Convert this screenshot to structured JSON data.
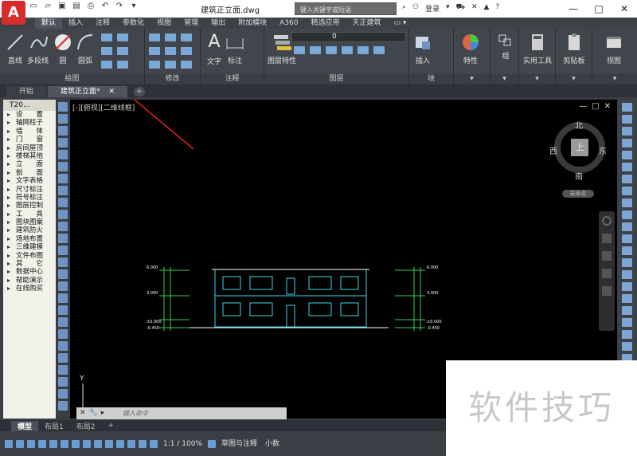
{
  "app": {
    "logo": "A",
    "doc_title": "建筑正立面.dwg"
  },
  "search": {
    "placeholder": "键入关键字或短语"
  },
  "login": {
    "label": "登录"
  },
  "window_controls": {
    "minimize": "—",
    "maximize": "□",
    "close": "✕"
  },
  "ribbon_tabs": [
    "默认",
    "插入",
    "注释",
    "参数化",
    "视图",
    "管理",
    "输出",
    "附加模块",
    "A360",
    "精选应用",
    "天正建筑"
  ],
  "active_ribbon_tab": "默认",
  "draw_panel": {
    "title": "绘图",
    "tools": [
      "直线",
      "多段线",
      "圆",
      "圆弧"
    ]
  },
  "modify_panel": {
    "title": "修改"
  },
  "annotation_panel": {
    "title": "注释",
    "tools": [
      "文字",
      "标注"
    ]
  },
  "layer_panel": {
    "title": "图层",
    "tools": [
      "图层特性"
    ],
    "current_layer": "0"
  },
  "block_panel": {
    "title": "块",
    "tools": [
      "插入"
    ]
  },
  "right_tools": [
    "特性",
    "组",
    "实用工具",
    "剪贴板",
    "视图"
  ],
  "doc_tabs": [
    "开始",
    "建筑正立面*"
  ],
  "active_doc_tab": "建筑正立面*",
  "palette": {
    "header": "T20...",
    "items": [
      "设　　置",
      "轴网柱子",
      "墙　　体",
      "门　　窗",
      "房间屋顶",
      "楼梯其他",
      "立　　面",
      "剖　　面",
      "文字表格",
      "尺寸标注",
      "符号标注",
      "图层控制",
      "工　　具",
      "图块图案",
      "建筑防火",
      "场地布置",
      "三维建模",
      "文件布图",
      "其　　它",
      "数据中心",
      "帮助演示",
      "在线购买"
    ]
  },
  "viewport": {
    "label": "[-][俯视][二维线框]",
    "controls": [
      "—",
      "□",
      "✕"
    ]
  },
  "viewcube": {
    "north": "北",
    "south": "南",
    "east": "东",
    "west": "西",
    "top": "上",
    "wcs": "未命名"
  },
  "ucs": {
    "y_label": "Y"
  },
  "drawing": {
    "left_elevs": [
      "6.000",
      "3.000",
      "±0.000",
      "-0.450"
    ],
    "right_elevs": [
      "6.000",
      "3.000",
      "±0.000",
      "-0.450"
    ]
  },
  "command_line": {
    "placeholder": "键入命令"
  },
  "layout_tabs": [
    "模型",
    "布局1",
    "布局2"
  ],
  "active_layout": "模型",
  "status": {
    "scale": "1:1 / 100%",
    "workspace": "草图与注释",
    "units": "小数"
  },
  "watermark": "软件技巧",
  "colors": {
    "accent_red": "#d62c2c",
    "line_cyan": "#39d8e8",
    "line_green": "#2ed34a",
    "ribbon_bg": "#41464d"
  }
}
